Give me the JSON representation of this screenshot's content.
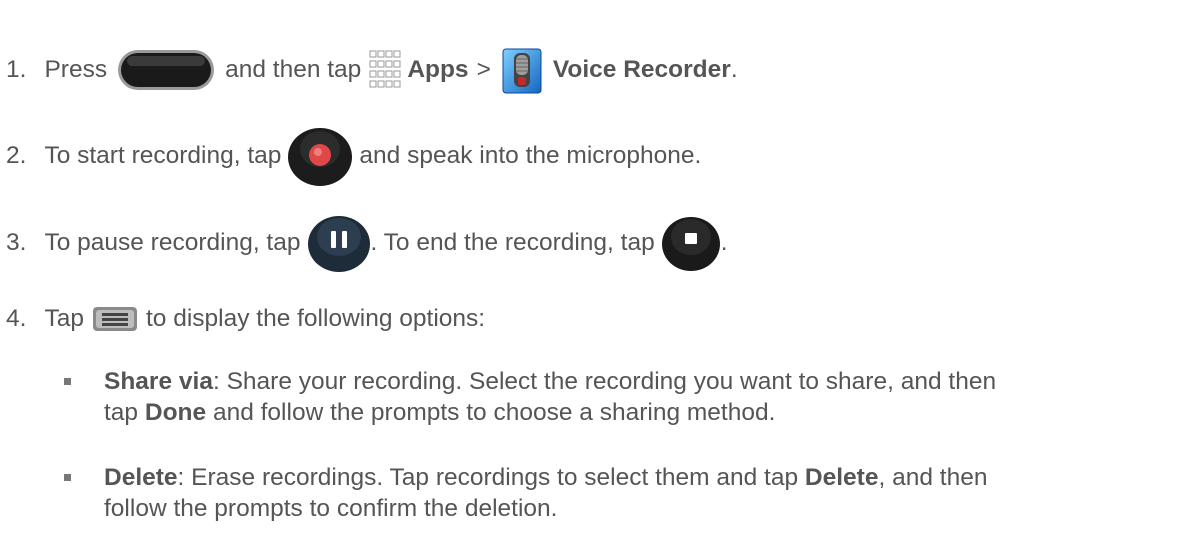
{
  "steps": [
    {
      "number": "1.",
      "pre": "Press",
      "mid": "and then tap",
      "apps_label": "Apps",
      "sep": ">",
      "voice_label": "Voice Recorder",
      "end": "."
    },
    {
      "number": "2.",
      "pre": "To start recording, tap",
      "post": "and speak into the microphone."
    },
    {
      "number": "3.",
      "pre": "To pause recording, tap",
      "mid": ". To end the recording, tap",
      "end": "."
    },
    {
      "number": "4.",
      "pre": "Tap",
      "post": "to display the following options:"
    }
  ],
  "options": [
    {
      "term": "Share via",
      "line1": ": Share your recording.  Select the recording you want to share, and then",
      "line2_pre": "tap",
      "line2_bold": "Done",
      "line2_post": "and follow the prompts to choose a sharing method."
    },
    {
      "term": "Delete",
      "line1_pre": ": Erase recordings. Tap recordings to select them and tap",
      "line1_bold": "Delete",
      "line1_post": ", and then",
      "line2": "follow the prompts to confirm the deletion."
    }
  ],
  "icons": [
    "home-key-icon",
    "apps-grid-icon",
    "voice-recorder-app-icon",
    "record-icon",
    "pause-icon",
    "stop-icon",
    "menu-key-icon"
  ]
}
